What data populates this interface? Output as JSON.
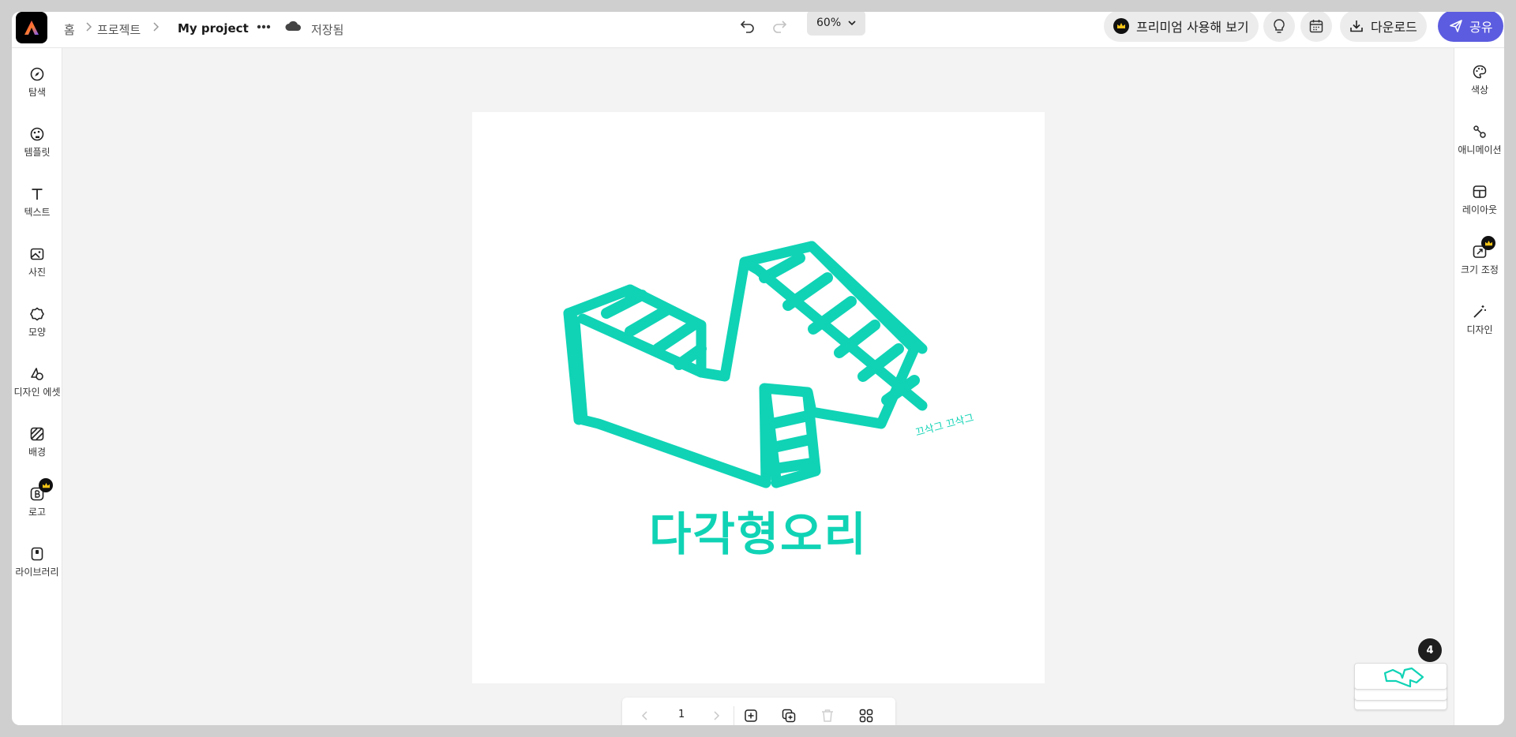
{
  "topbar": {
    "breadcrumb_home": "홈",
    "breadcrumb_projects": "프로젝트",
    "project_name": "My project",
    "save_status": "저장됨",
    "zoom_level": "60%",
    "premium_label": "프리미엄 사용해 보기",
    "download_label": "다운로드",
    "share_label": "공유"
  },
  "left_rail": {
    "items": [
      {
        "label": "탐색",
        "icon": "compass-icon"
      },
      {
        "label": "템플릿",
        "icon": "template-icon"
      },
      {
        "label": "텍스트",
        "icon": "text-icon"
      },
      {
        "label": "사진",
        "icon": "photo-icon"
      },
      {
        "label": "모양",
        "icon": "shape-icon"
      },
      {
        "label": "디자인 에셋",
        "icon": "design-assets-icon"
      },
      {
        "label": "배경",
        "icon": "background-icon"
      },
      {
        "label": "로고",
        "icon": "logo-icon",
        "premium": true
      },
      {
        "label": "라이브러리",
        "icon": "library-icon"
      }
    ]
  },
  "right_rail": {
    "items": [
      {
        "label": "색상",
        "icon": "palette-icon"
      },
      {
        "label": "애니메이션",
        "icon": "animation-icon"
      },
      {
        "label": "레이아웃",
        "icon": "layout-icon"
      },
      {
        "label": "크기 조정",
        "icon": "resize-icon",
        "premium": true
      },
      {
        "label": "디자인",
        "icon": "magic-wand-icon"
      }
    ]
  },
  "canvas": {
    "brand_text": "다각형오리",
    "sfx_text": "끄삭그 끄삭그",
    "accent_color": "#10d3b5"
  },
  "pagebar": {
    "page_number": "1"
  },
  "pages": {
    "count": "4"
  },
  "colors": {
    "share_button": "#5c5ce0",
    "premium_crown": "#f5c518"
  }
}
